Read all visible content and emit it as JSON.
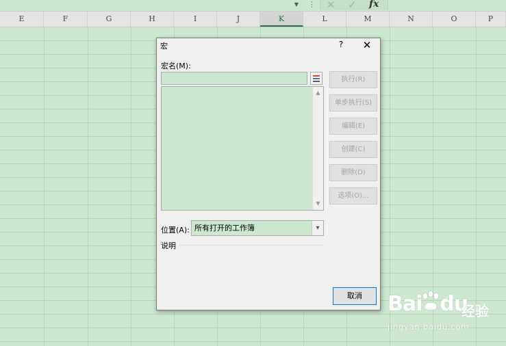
{
  "formula_bar": {
    "dropdown_glyph": "▼",
    "more_glyph": "⋮",
    "cancel_glyph": "✕",
    "confirm_glyph": "✓",
    "fx_label": "fx"
  },
  "columns": [
    "E",
    "F",
    "G",
    "H",
    "I",
    "J",
    "K",
    "L",
    "M",
    "N",
    "O",
    "P"
  ],
  "active_column": "K",
  "dialog": {
    "title": "宏",
    "help_glyph": "?",
    "close_glyph": "✕",
    "macro_name_label": "宏名(M):",
    "macro_name_value": "",
    "macros": [],
    "buttons": {
      "run": "执行(R)",
      "step_into": "单步执行(S)",
      "edit": "编辑(E)",
      "create": "创建(C)",
      "delete": "删除(D)",
      "options": "选项(O)..."
    },
    "location_label": "位置(A):",
    "location_value": "所有打开的工作簿",
    "description_label": "说明",
    "cancel": "取消"
  },
  "watermark": {
    "logo": "Bai",
    "logo_suffix": "du",
    "brand": "经验",
    "url": "jingyan.baidu.com"
  },
  "colors": {
    "sheet_background": "#cce8cf",
    "dialog_background": "#f0f0f0",
    "focus_border": "#0078d7",
    "disabled_text": "#a2a2a2"
  }
}
